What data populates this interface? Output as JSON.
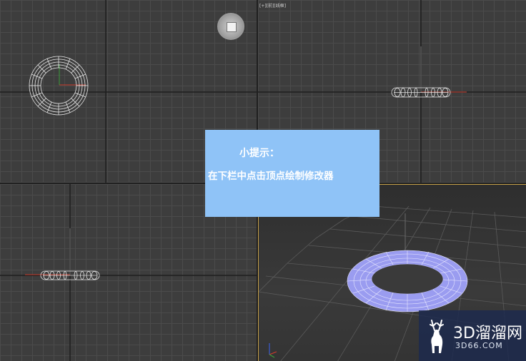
{
  "viewport_label": "[+][前][线框]",
  "hint": {
    "title": "小提示：",
    "body": "在下栏中点击顶点绘制修改器"
  },
  "watermark": {
    "brand": "3D溜溜网",
    "url": "3D66.COM"
  },
  "colors": {
    "hint_bg": "#8fc3f7",
    "active_border": "#c8a24a",
    "torus_shaded": "#9a9cf0",
    "axis_x": "#cc3b2c",
    "axis_y": "#3b9b3b",
    "axis_z": "#3b5bd0"
  },
  "icons": [
    "viewcube-icon",
    "deer-logo-icon"
  ]
}
